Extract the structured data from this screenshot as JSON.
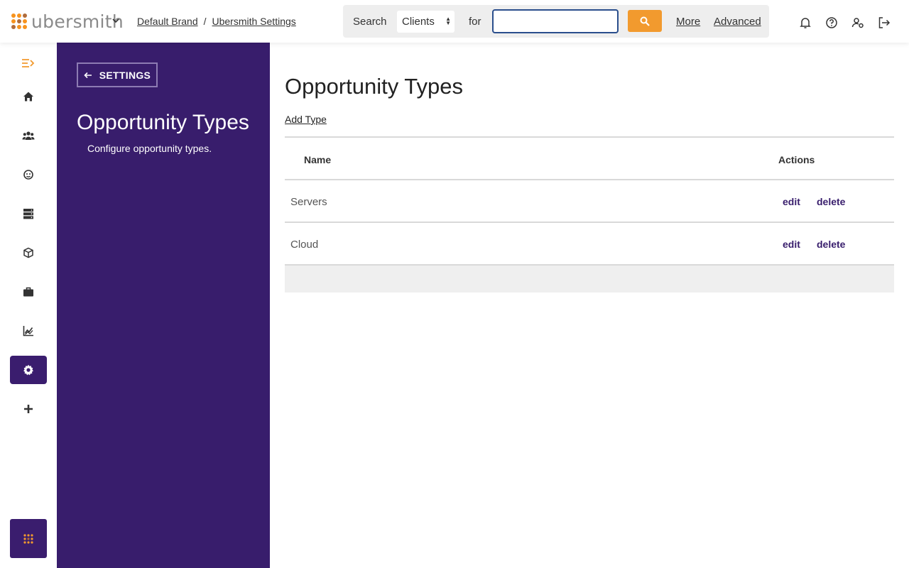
{
  "brand": {
    "logo_text": "ubersmith"
  },
  "breadcrumb": {
    "items": [
      "Default Brand",
      "Ubersmith Settings"
    ],
    "separator": "/"
  },
  "search": {
    "label": "Search",
    "scope_selected": "Clients",
    "for_label": "for",
    "input_value": "",
    "more_label": "More",
    "advanced_label": "Advanced"
  },
  "top_icons": [
    "bell-icon",
    "help-icon",
    "user-settings-icon",
    "logout-icon"
  ],
  "rail": {
    "items": [
      "collapse-icon",
      "home-icon",
      "clients-icon",
      "support-icon",
      "servers-icon",
      "packages-icon",
      "briefcase-icon",
      "reports-icon",
      "settings-icon",
      "plus-icon"
    ],
    "active": "settings-icon",
    "bottom": "apps-grid-icon"
  },
  "side_panel": {
    "back_label": "SETTINGS",
    "title": "Opportunity Types",
    "subtitle": "Configure opportunity types."
  },
  "main": {
    "title": "Opportunity Types",
    "add_label": "Add Type",
    "columns": {
      "name": "Name",
      "actions": "Actions"
    },
    "rows": [
      {
        "name": "Servers",
        "edit": "edit",
        "delete": "delete"
      },
      {
        "name": "Cloud",
        "edit": "edit",
        "delete": "delete"
      }
    ]
  },
  "colors": {
    "brand_purple": "#381d6c",
    "accent_orange": "#f29a2e",
    "focus_blue": "#2a4e8c"
  }
}
